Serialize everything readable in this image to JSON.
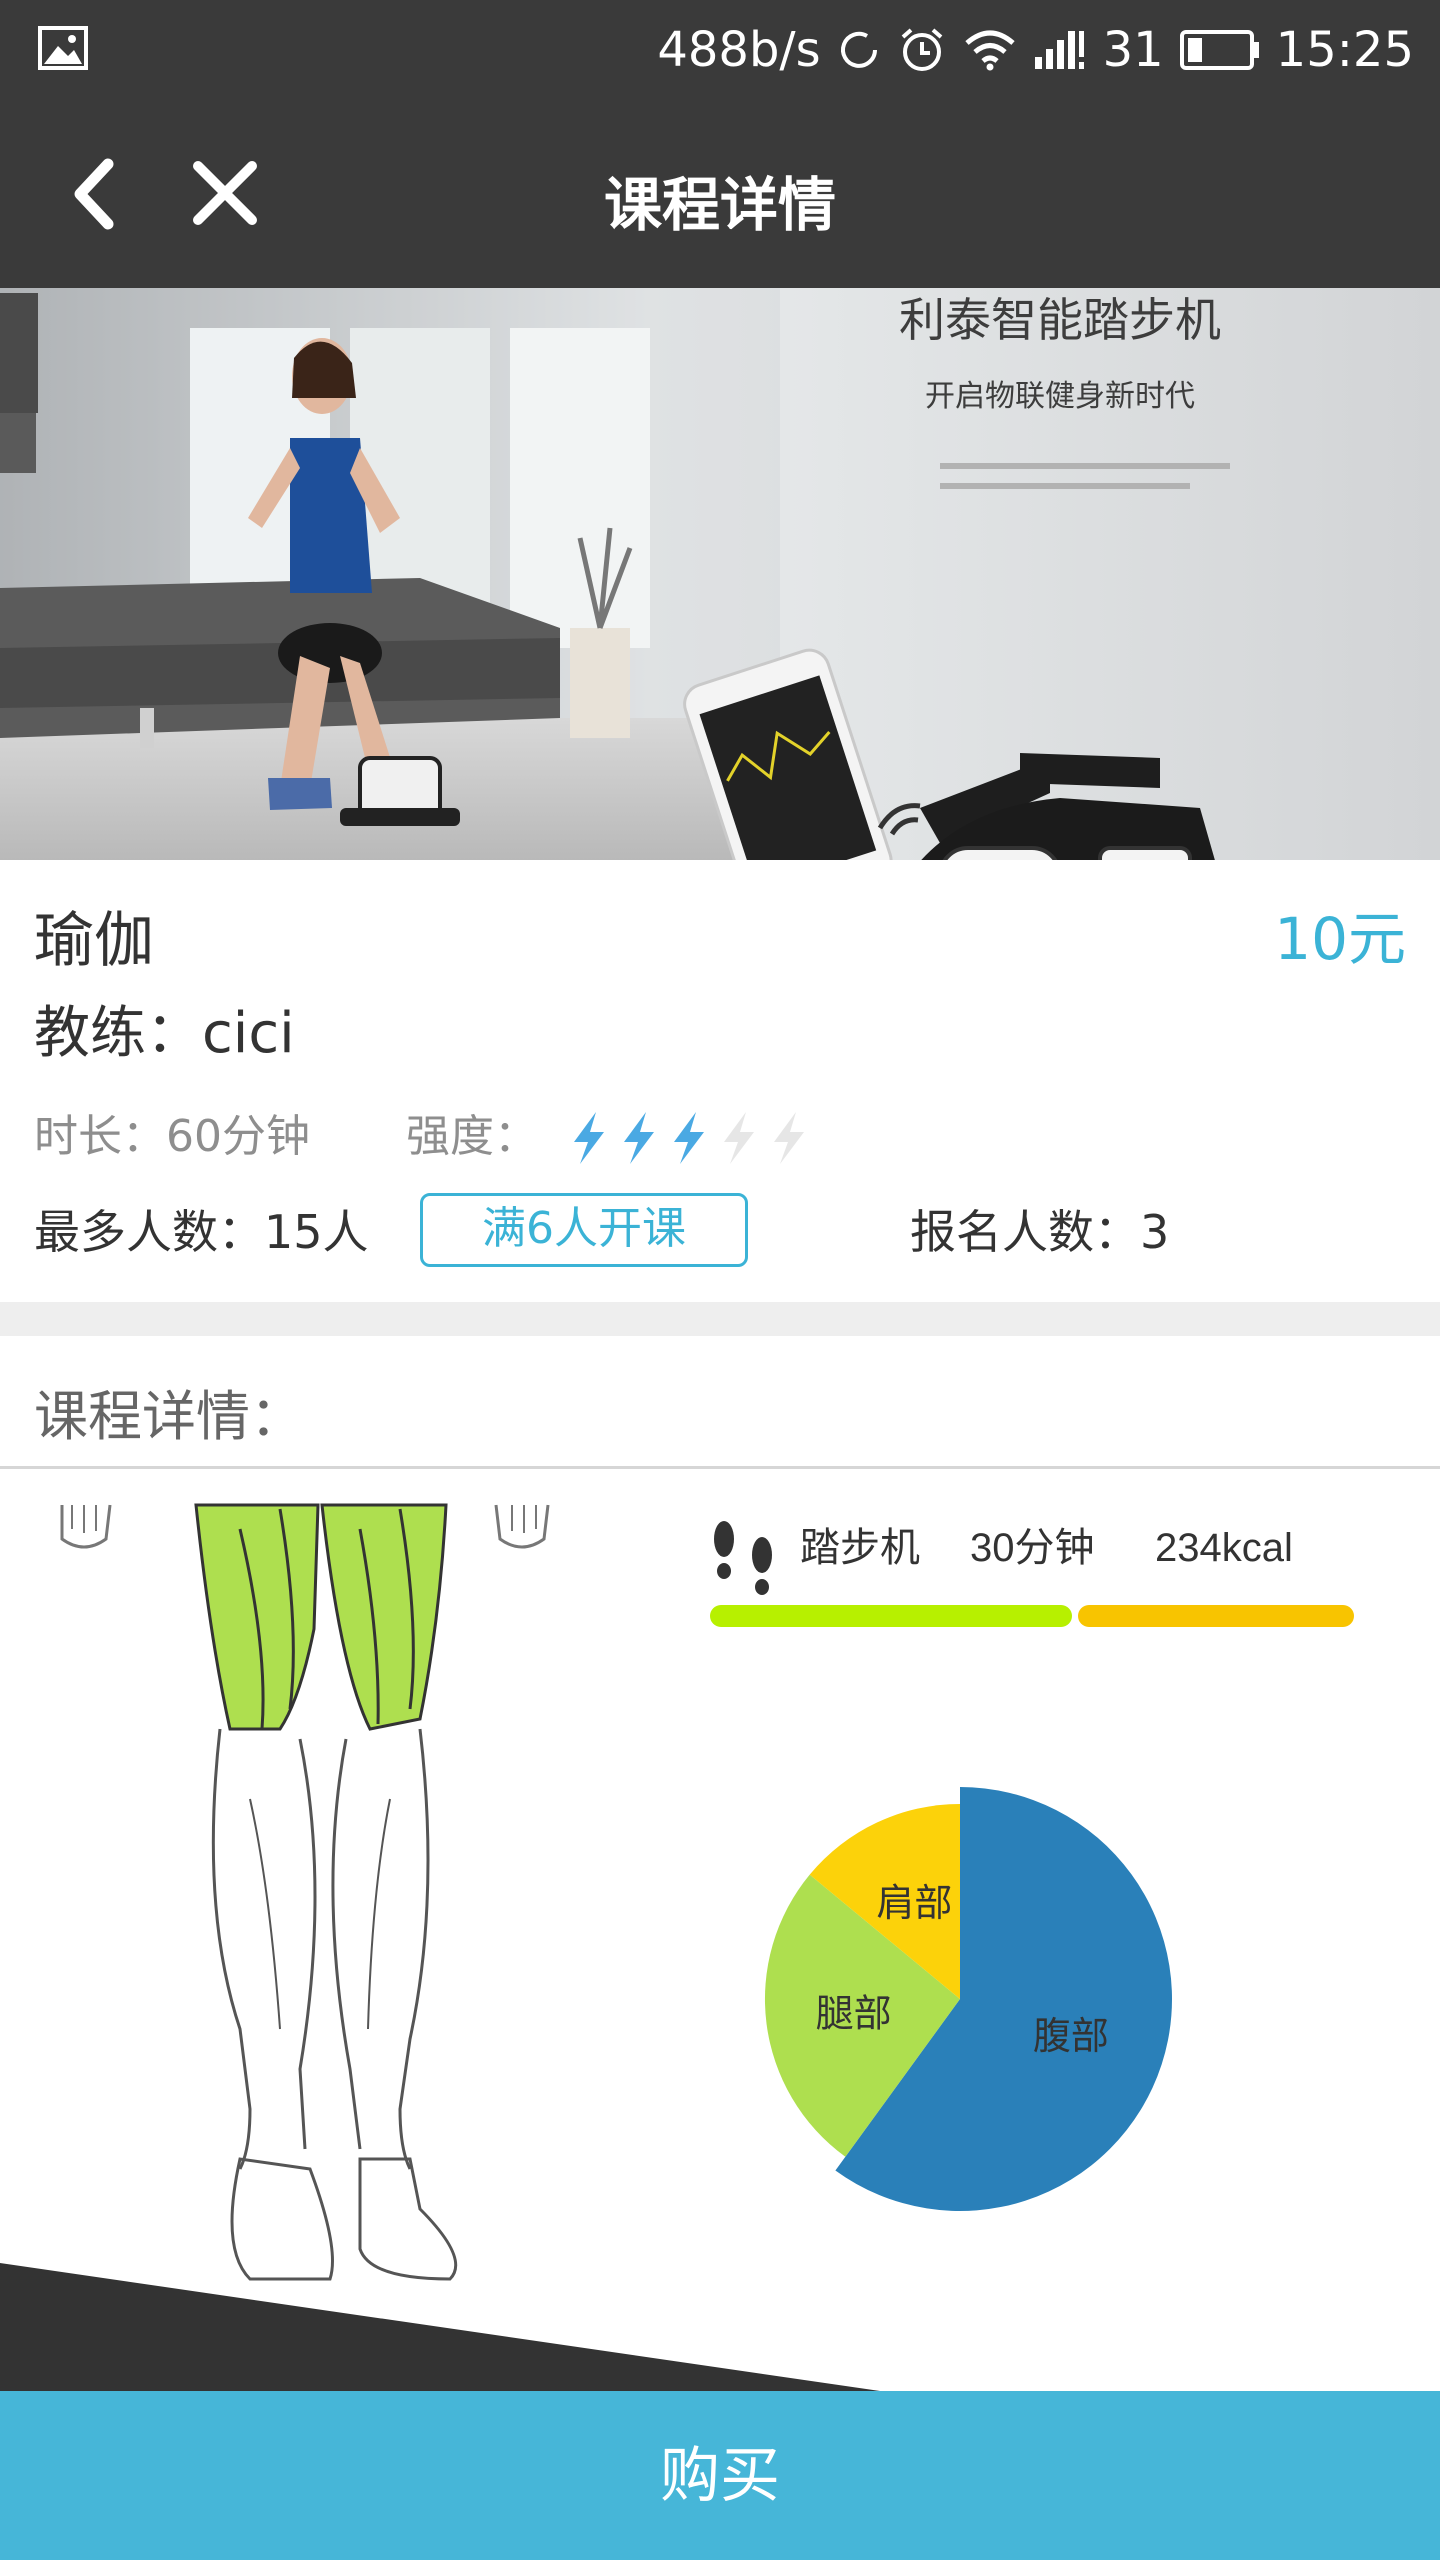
{
  "status_bar": {
    "net_speed": "488b/s",
    "battery_level": "31",
    "time": "15:25"
  },
  "header": {
    "title": "课程详情"
  },
  "banner": {
    "headline": "利泰智能踏步机",
    "subheadline": "开启物联健身新时代"
  },
  "course": {
    "name": "瑜伽",
    "price": "10元",
    "coach_label": "教练：",
    "coach_name": "cici",
    "duration_label": "时长：",
    "duration": "60分钟",
    "intensity_label": "强度：",
    "intensity_level": 3,
    "intensity_max": 5,
    "max_people_label": "最多人数：",
    "max_people": "15人",
    "open_condition": "满6人开课",
    "enrolled_label": "报名人数：",
    "enrolled": "3"
  },
  "details": {
    "title": "课程详情：",
    "machine": "踏步机",
    "minutes": "30分钟",
    "calories": "234kcal",
    "pie": [
      {
        "label": "腹部",
        "value": 60,
        "color": "#2a80b9"
      },
      {
        "label": "腿部",
        "value": 26,
        "color": "#aedf4f"
      },
      {
        "label": "肩部",
        "value": 14,
        "color": "#fcd20a"
      }
    ]
  },
  "footer": {
    "buy_label": "购买"
  },
  "colors": {
    "accent": "#3bb3d6",
    "bar_green": "#b7f000",
    "bar_yellow": "#f8c400",
    "header_bg": "#3a3a3a"
  }
}
